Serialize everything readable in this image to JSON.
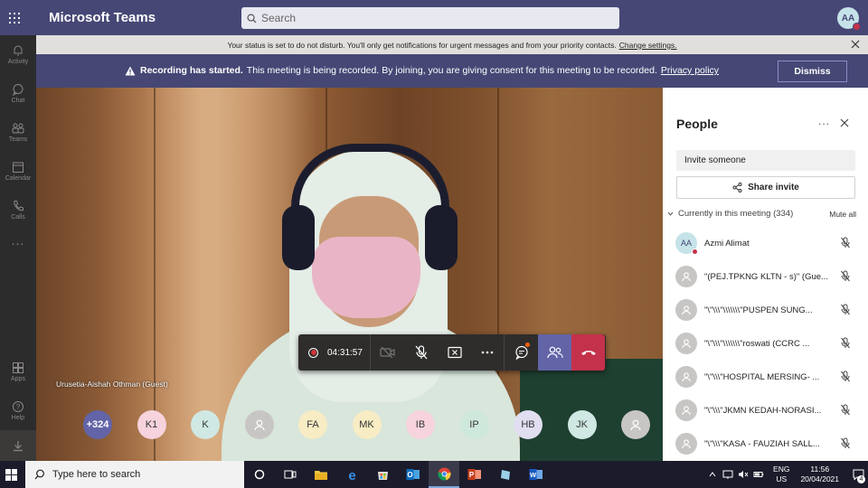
{
  "app": {
    "title": "Microsoft Teams",
    "search_placeholder": "Search",
    "user_initials": "AA"
  },
  "rail": {
    "items": [
      {
        "label": "Activity",
        "icon": "bell-icon"
      },
      {
        "label": "Chat",
        "icon": "chat-icon"
      },
      {
        "label": "Teams",
        "icon": "teams-icon"
      },
      {
        "label": "Calendar",
        "icon": "calendar-icon"
      },
      {
        "label": "Calls",
        "icon": "phone-icon"
      }
    ],
    "more": "...",
    "bottom_items": [
      {
        "label": "Apps",
        "icon": "apps-icon"
      },
      {
        "label": "Help",
        "icon": "help-icon"
      }
    ]
  },
  "status_bar": {
    "text": "Your status is set to do not disturb. You'll only get notifications for urgent messages and from your priority contacts.",
    "link": "Change settings."
  },
  "recording_bar": {
    "title": "Recording has started.",
    "text": "This meeting is being recorded. By joining, you are giving consent for this meeting to be recorded.",
    "link": "Privacy policy",
    "dismiss": "Dismiss"
  },
  "video": {
    "speaker_name": "Urusetia-Aishah Othman (Guest)"
  },
  "controls": {
    "timer": "04:31:57"
  },
  "avatar_row": [
    {
      "label": "+324",
      "bg": "#6264a7",
      "fg": "#ffffff"
    },
    {
      "label": "K1",
      "bg": "#f6d3dd",
      "fg": "#333333"
    },
    {
      "label": "K",
      "bg": "#cfe8e3",
      "fg": "#333333"
    },
    {
      "label": "",
      "bg": "#c8c6c4",
      "fg": "#333333"
    },
    {
      "label": "FA",
      "bg": "#f7ecc4",
      "fg": "#333333"
    },
    {
      "label": "MK",
      "bg": "#f7ecc4",
      "fg": "#333333"
    },
    {
      "label": "IB",
      "bg": "#f6d3dd",
      "fg": "#333333"
    },
    {
      "label": "IP",
      "bg": "#cfe8dc",
      "fg": "#333333"
    },
    {
      "label": "HB",
      "bg": "#e0def0",
      "fg": "#333333"
    },
    {
      "label": "JK",
      "bg": "#cfe8e3",
      "fg": "#333333"
    },
    {
      "label": "",
      "bg": "#c8c6c4",
      "fg": "#333333"
    }
  ],
  "people": {
    "title": "People",
    "more": "...",
    "invite_placeholder": "Invite someone",
    "share_invite": "Share invite",
    "section_title": "Currently in this meeting (334)",
    "mute_all": "Mute all",
    "participants": [
      {
        "initials": "AA",
        "name": "Azmi Alimat"
      },
      {
        "initials": "",
        "name": "\"(PEJ.TPKNG KLTN - s)\" (Gue..."
      },
      {
        "initials": "",
        "name": "\"\\\"\\\\\\\"\\\\\\\\\\\\\\\"PUSPEN SUNG..."
      },
      {
        "initials": "",
        "name": "\"\\\"\\\\\\\"\\\\\\\\\\\\\\\"roswati (CCRC ..."
      },
      {
        "initials": "",
        "name": "\"\\\"\\\\\\\"HOSPITAL MERSING- ..."
      },
      {
        "initials": "",
        "name": "\"\\\"\\\\\\\"JKMN KEDAH-NORASI..."
      },
      {
        "initials": "",
        "name": "\"\\\"\\\\\\\"KASA - FAUZIAH SALL..."
      }
    ]
  },
  "taskbar": {
    "search_placeholder": "Type here to search",
    "lang_top": "ENG",
    "lang_bottom": "US",
    "time": "11:56",
    "date": "20/04/2021",
    "notification_count": "4"
  }
}
